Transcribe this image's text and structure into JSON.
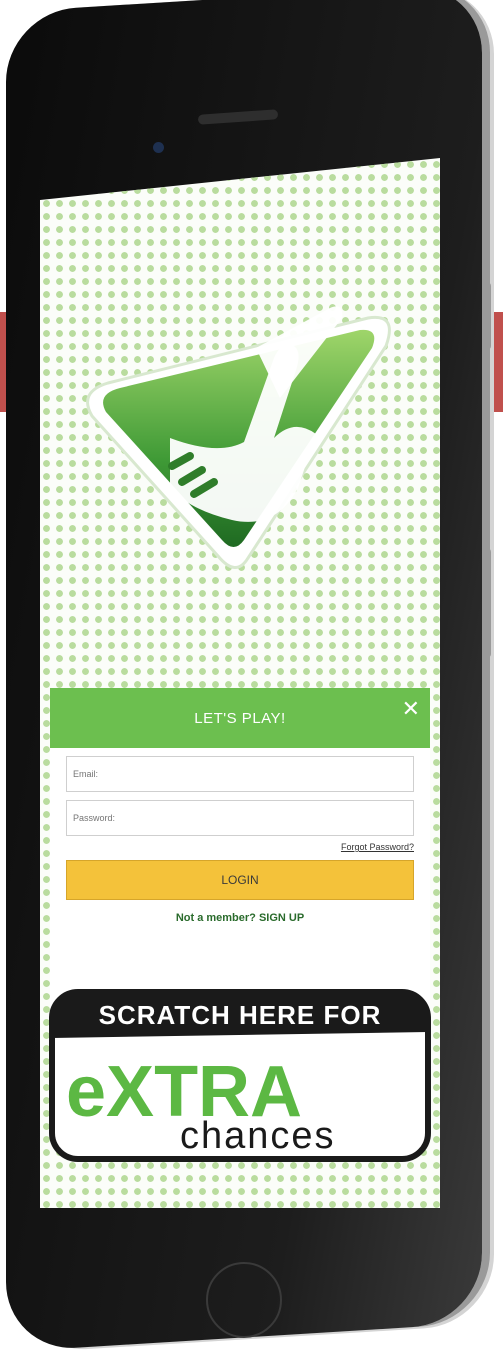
{
  "login": {
    "title": "LET'S PLAY!",
    "close_label": "✕",
    "email_placeholder": "Email:",
    "password_placeholder": "Password:",
    "forgot_label": "Forgot Password?",
    "login_label": "LOGIN",
    "signup_label": "Not a member? SIGN UP"
  },
  "promo": {
    "line1": "SCRATCH HERE FOR",
    "brand_big": "eXTRA",
    "brand_small": "chances"
  },
  "colors": {
    "brand_green": "#6cbf4f",
    "button_yellow": "#f4c23a",
    "accent_red": "#c0504d",
    "signup_green": "#2a6b2c"
  },
  "icons": {
    "logo": "fingers-crossed-logo-icon",
    "close": "close-icon"
  }
}
